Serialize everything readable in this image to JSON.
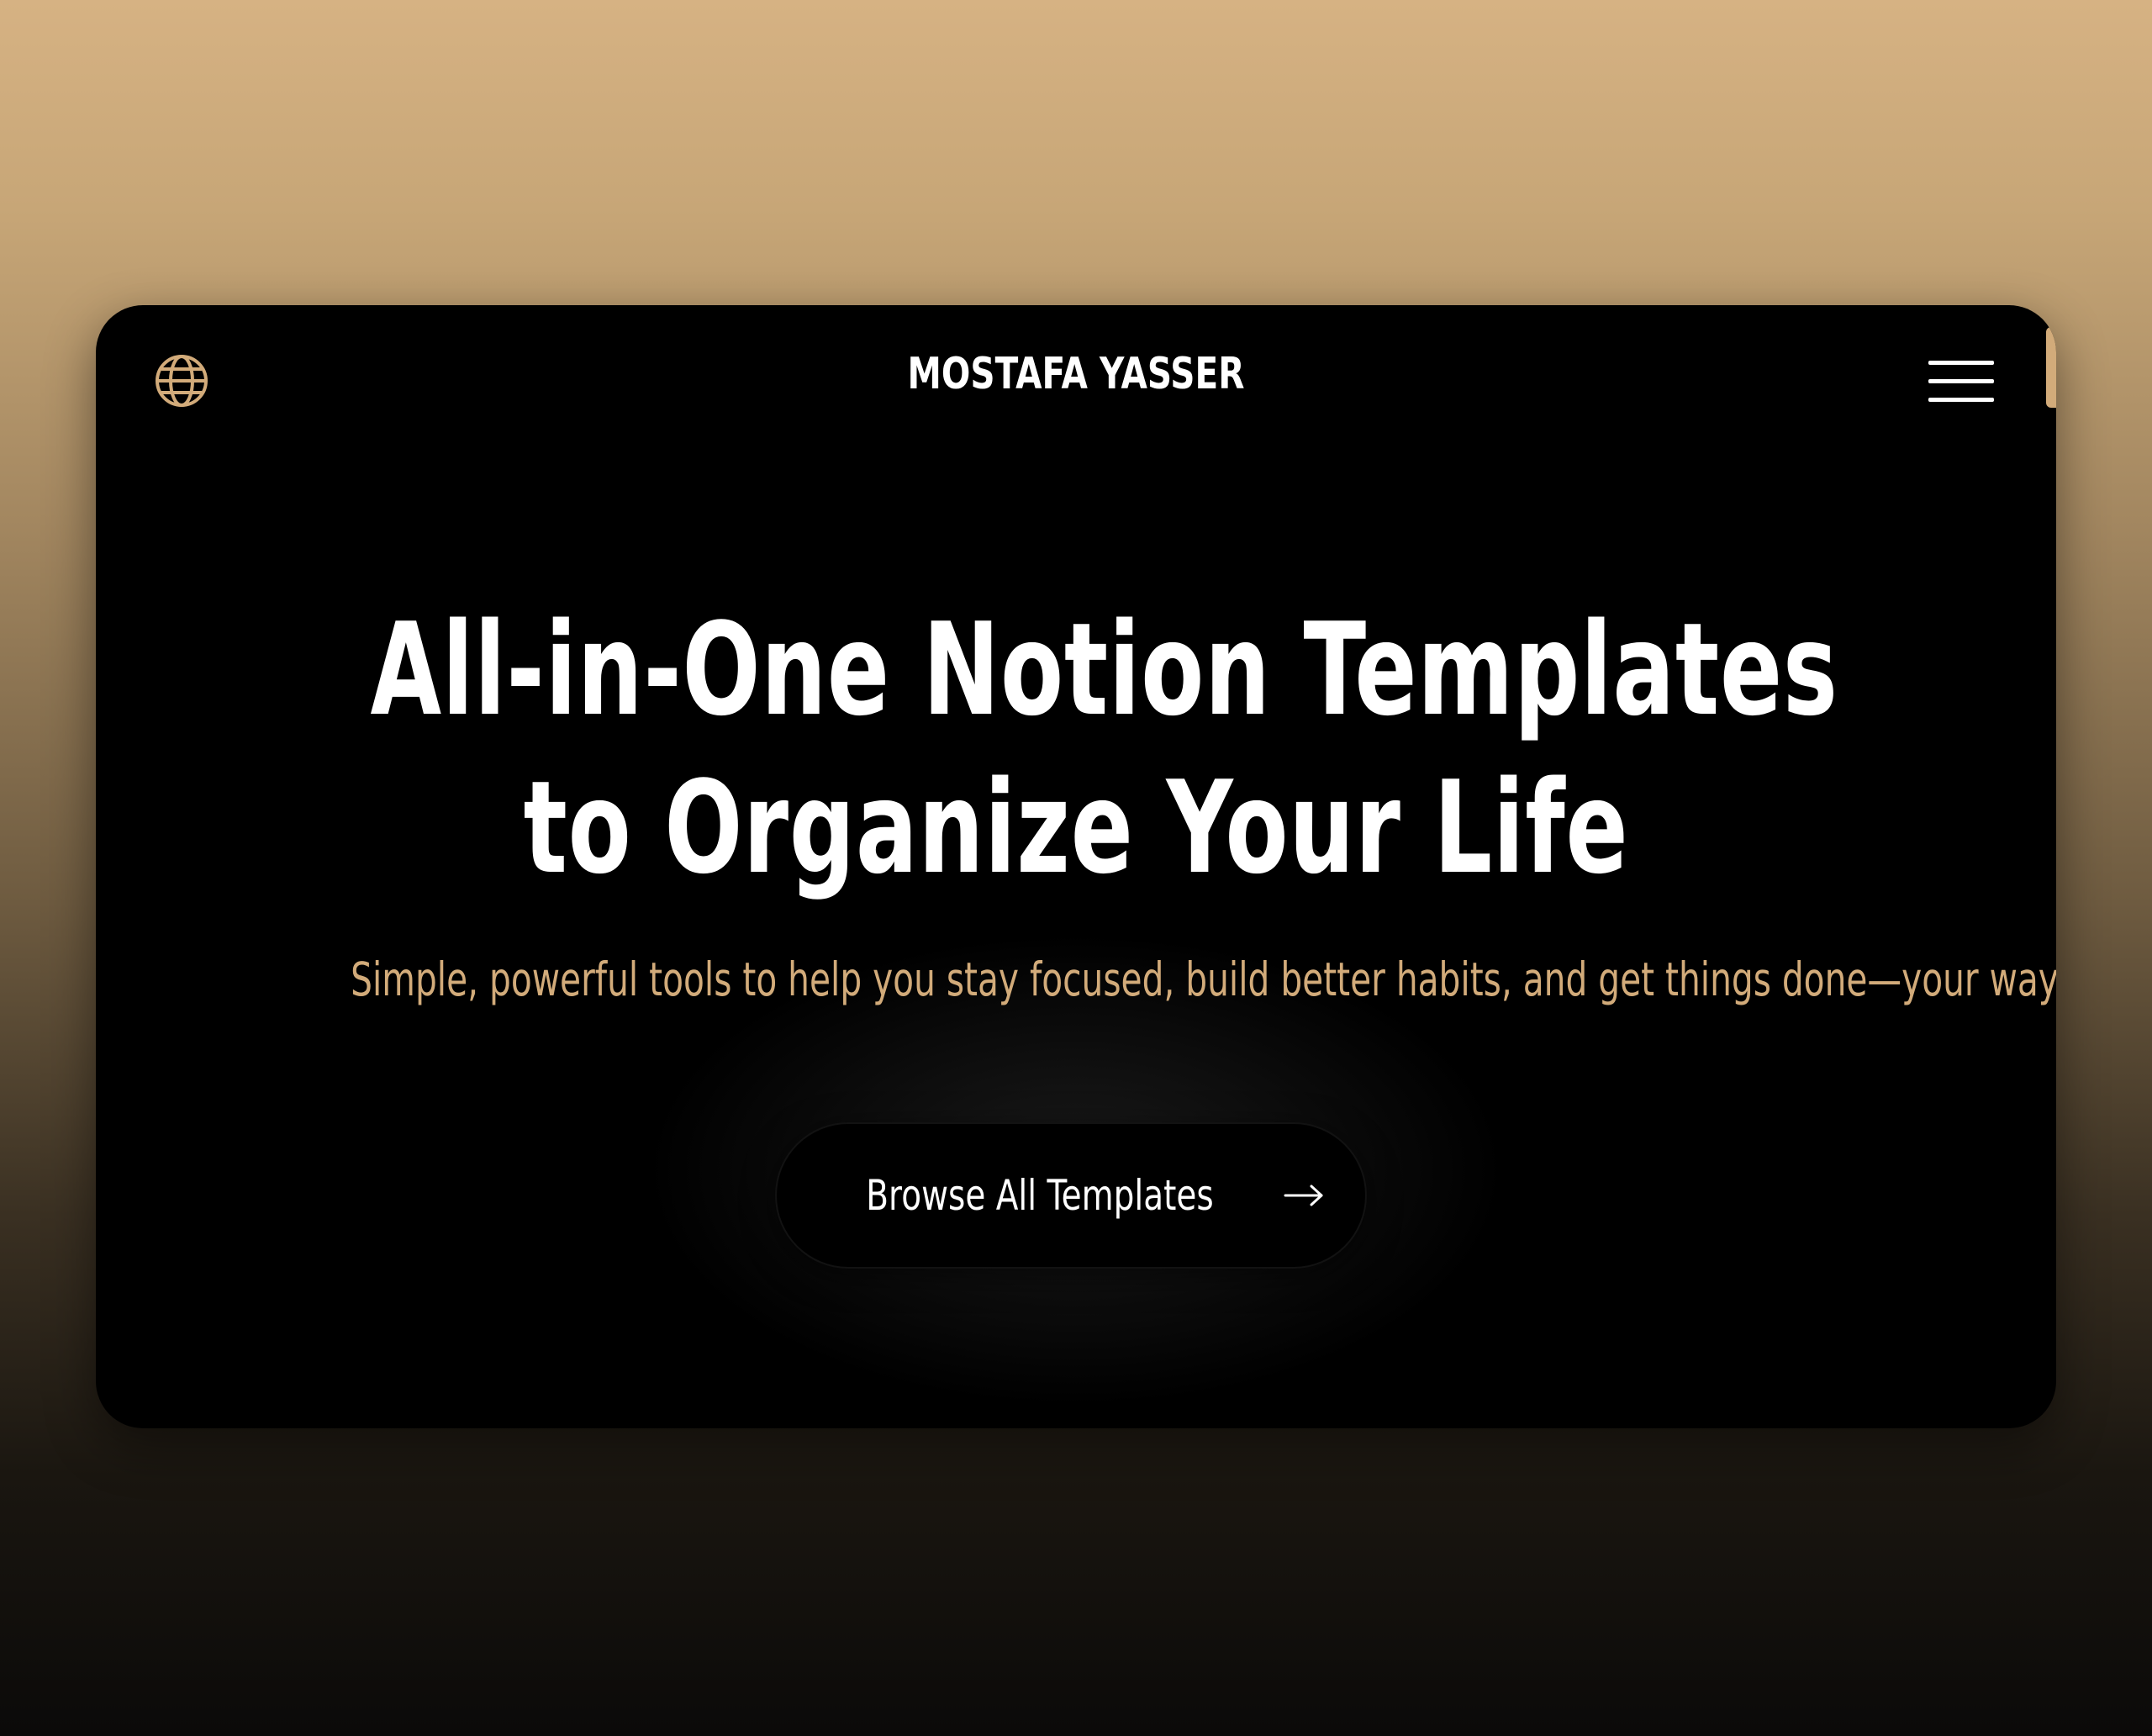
{
  "header": {
    "brand": "MOSTAFA YASSER",
    "language_icon": "globe-icon",
    "menu_icon": "hamburger-menu-icon"
  },
  "hero": {
    "headline_line1": "All-in-One Notion Templates",
    "headline_line2": "to Organize Your Life",
    "subheadline": "Simple, powerful tools to help you stay focused, build better habits, and get things done—your way.",
    "cta_label": "Browse All Templates",
    "cta_icon": "arrow-right-icon"
  },
  "colors": {
    "accent": "#d2ab7a",
    "card_background": "#000000",
    "text_primary": "#ffffff"
  }
}
